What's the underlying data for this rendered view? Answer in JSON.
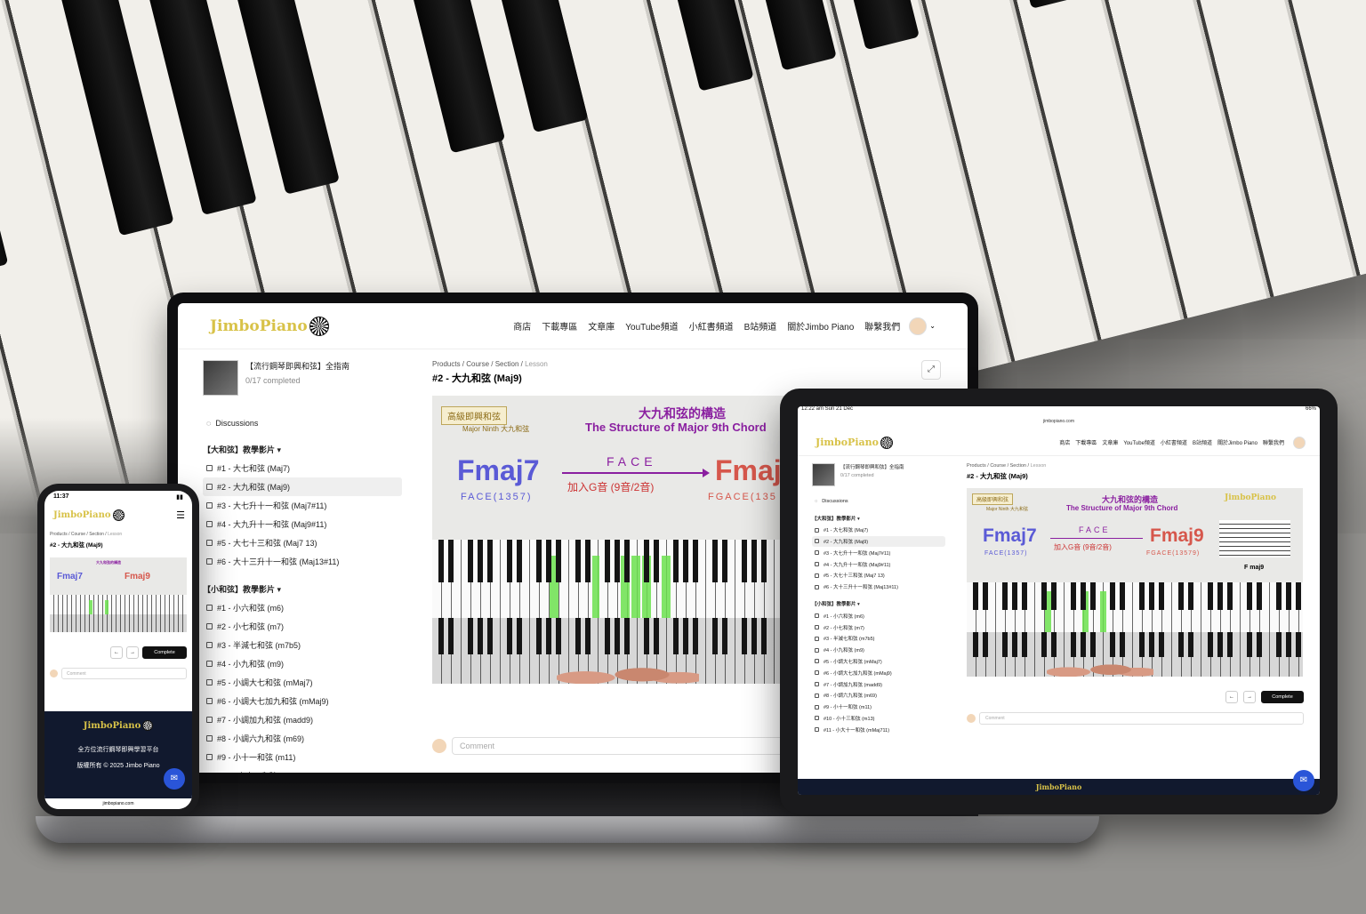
{
  "brand": {
    "logo_text": "JimboPiano",
    "accent": "#d8c248",
    "footer_bg": "#11192e"
  },
  "nav": {
    "links": [
      "商店",
      "下載專區",
      "文章庫",
      "YouTube頻道",
      "小紅書頻道",
      "B站頻道",
      "關於Jimbo Piano",
      "聯繫我們"
    ],
    "chevron": "⌄"
  },
  "course": {
    "title": "【流行鋼琴即興和弦】全指南",
    "progress": "0/17 completed",
    "discussions": "Discussions"
  },
  "sections": [
    {
      "title": "【大和弦】教學影片 ▾",
      "items": [
        "#1 - 大七和弦 (Maj7)",
        "#2 - 大九和弦 (Maj9)",
        "#3 - 大七升十一和弦 (Maj7#11)",
        "#4 - 大九升十一和弦 (Maj9#11)",
        "#5 - 大七十三和弦 (Maj7 13)",
        "#6 - 大十三升十一和弦 (Maj13#11)"
      ]
    },
    {
      "title": "【小和弦】教學影片 ▾",
      "items": [
        "#1 - 小六和弦 (m6)",
        "#2 - 小七和弦 (m7)",
        "#3 - 半減七和弦 (m7b5)",
        "#4 - 小九和弦 (m9)",
        "#5 - 小調大七和弦 (mMaj7)",
        "#6 - 小調大七加九和弦 (mMaj9)",
        "#7 - 小調加九和弦 (madd9)",
        "#8 - 小調六九和弦 (m69)",
        "#9 - 小十一和弦 (m11)",
        "#10 - 小十三和弦 (m13)",
        "#11 - 小大十一和弦 (mMaj711)"
      ]
    }
  ],
  "lesson": {
    "breadcrumb": {
      "products": "Products",
      "course": "Course",
      "section": "Section",
      "lesson": "Lesson",
      "sep": " / "
    },
    "title": "#2 - 大九和弦 (Maj9)",
    "expand_icon": "⤢",
    "comment_placeholder": "Comment",
    "complete_label": "Complete",
    "prev_icon": "←",
    "next_icon": "→"
  },
  "video": {
    "tag1": "高級即興和弦",
    "tag2": "Major Ninth 大九和弦",
    "heading_zh": "大九和弦的構造",
    "heading_en": "The Structure of Major 9th Chord",
    "left_chord": "Fmaj7",
    "left_notes": "FACE(1357)",
    "mid_notes": "FACE",
    "add_text": "加入G音 (9音/2音)",
    "right_chord": "Fmaj9",
    "right_notes": "FGACE(13579)",
    "right_notes_short": "FGACE(135",
    "right_chord_short": "Fmaj",
    "heading_en_short": "The Structure of Major 9th Chord",
    "staff_label": "F maj9",
    "highlight_color": "#6be04d"
  },
  "tablet": {
    "time": "12:22 am  Sun 21 Dec",
    "battery": "66%",
    "url": "jimbopiano.com"
  },
  "phone": {
    "time": "11:37",
    "footer_slogan": "全方位流行鋼琴即興學習平台",
    "footer_copy": "版權所有 © 2025 Jimbo Piano",
    "url": "jimbopiano.com",
    "menu_icon": "☰"
  },
  "icons": {
    "chat": "chat-bubble-icon",
    "lesson": "lesson-box-icon"
  }
}
